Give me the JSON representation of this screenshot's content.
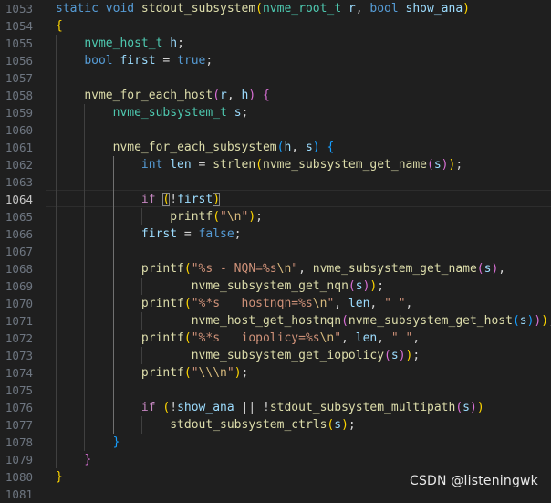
{
  "editor": {
    "active_line": "1064",
    "lines": [
      {
        "num": "1053",
        "tokens": [
          [
            "static void ",
            "t-kw"
          ],
          [
            "stdout_subsystem",
            "t-fn"
          ],
          [
            "(",
            "t-p1"
          ],
          [
            "nvme_root_t",
            "t-ty"
          ],
          [
            " ",
            "t-txt"
          ],
          [
            "r",
            "t-var"
          ],
          [
            ", ",
            "t-txt"
          ],
          [
            "bool",
            "t-kw"
          ],
          [
            " ",
            "t-txt"
          ],
          [
            "show_ana",
            "t-var"
          ],
          [
            ")",
            "t-p1"
          ]
        ]
      },
      {
        "num": "1054",
        "tokens": [
          [
            "{",
            "t-p1"
          ]
        ]
      },
      {
        "num": "1055",
        "tokens": [
          [
            "    ",
            "t-txt"
          ],
          [
            "nvme_host_t",
            "t-ty"
          ],
          [
            " ",
            "t-txt"
          ],
          [
            "h",
            "t-var"
          ],
          [
            ";",
            "t-txt"
          ]
        ]
      },
      {
        "num": "1056",
        "tokens": [
          [
            "    ",
            "t-txt"
          ],
          [
            "bool",
            "t-kw"
          ],
          [
            " ",
            "t-txt"
          ],
          [
            "first",
            "t-var"
          ],
          [
            " = ",
            "t-txt"
          ],
          [
            "true",
            "t-kw"
          ],
          [
            ";",
            "t-txt"
          ]
        ]
      },
      {
        "num": "1057",
        "tokens": []
      },
      {
        "num": "1058",
        "tokens": [
          [
            "    ",
            "t-txt"
          ],
          [
            "nvme_for_each_host",
            "t-fn"
          ],
          [
            "(",
            "t-p2"
          ],
          [
            "r",
            "t-var"
          ],
          [
            ", ",
            "t-txt"
          ],
          [
            "h",
            "t-var"
          ],
          [
            ")",
            "t-p2"
          ],
          [
            " ",
            "t-txt"
          ],
          [
            "{",
            "t-p2"
          ]
        ]
      },
      {
        "num": "1059",
        "tokens": [
          [
            "        ",
            "t-txt"
          ],
          [
            "nvme_subsystem_t",
            "t-ty"
          ],
          [
            " ",
            "t-txt"
          ],
          [
            "s",
            "t-var"
          ],
          [
            ";",
            "t-txt"
          ]
        ]
      },
      {
        "num": "1060",
        "tokens": []
      },
      {
        "num": "1061",
        "tokens": [
          [
            "        ",
            "t-txt"
          ],
          [
            "nvme_for_each_subsystem",
            "t-fn"
          ],
          [
            "(",
            "t-p3"
          ],
          [
            "h",
            "t-var"
          ],
          [
            ", ",
            "t-txt"
          ],
          [
            "s",
            "t-var"
          ],
          [
            ")",
            "t-p3"
          ],
          [
            " ",
            "t-txt"
          ],
          [
            "{",
            "t-p3"
          ]
        ]
      },
      {
        "num": "1062",
        "tokens": [
          [
            "            ",
            "t-txt"
          ],
          [
            "int",
            "t-kw"
          ],
          [
            " ",
            "t-txt"
          ],
          [
            "len",
            "t-var"
          ],
          [
            " = ",
            "t-txt"
          ],
          [
            "strlen",
            "t-fn"
          ],
          [
            "(",
            "t-p1"
          ],
          [
            "nvme_subsystem_get_name",
            "t-fn"
          ],
          [
            "(",
            "t-p2"
          ],
          [
            "s",
            "t-var"
          ],
          [
            ")",
            "t-p2"
          ],
          [
            ")",
            "t-p1"
          ],
          [
            ";",
            "t-txt"
          ]
        ]
      },
      {
        "num": "1063",
        "tokens": []
      },
      {
        "num": "1064",
        "tokens": [
          [
            "            ",
            "t-txt"
          ],
          [
            "if",
            "t-ctl"
          ],
          [
            " ",
            "t-txt"
          ],
          [
            "(",
            "t-p1 bracket-match"
          ],
          [
            "!",
            "t-txt"
          ],
          [
            "first",
            "t-var"
          ],
          [
            ")",
            "t-p1 bracket-match"
          ]
        ]
      },
      {
        "num": "1065",
        "tokens": [
          [
            "                ",
            "t-txt"
          ],
          [
            "printf",
            "t-fn"
          ],
          [
            "(",
            "t-p1"
          ],
          [
            "\"",
            "t-str"
          ],
          [
            "\\n",
            "t-esc"
          ],
          [
            "\"",
            "t-str"
          ],
          [
            ")",
            "t-p1"
          ],
          [
            ";",
            "t-txt"
          ]
        ]
      },
      {
        "num": "1066",
        "tokens": [
          [
            "            ",
            "t-txt"
          ],
          [
            "first",
            "t-var"
          ],
          [
            " = ",
            "t-txt"
          ],
          [
            "false",
            "t-kw"
          ],
          [
            ";",
            "t-txt"
          ]
        ]
      },
      {
        "num": "1067",
        "tokens": []
      },
      {
        "num": "1068",
        "tokens": [
          [
            "            ",
            "t-txt"
          ],
          [
            "printf",
            "t-fn"
          ],
          [
            "(",
            "t-p1"
          ],
          [
            "\"%s - NQN=%s",
            "t-str"
          ],
          [
            "\\n",
            "t-esc"
          ],
          [
            "\"",
            "t-str"
          ],
          [
            ", ",
            "t-txt"
          ],
          [
            "nvme_subsystem_get_name",
            "t-fn"
          ],
          [
            "(",
            "t-p2"
          ],
          [
            "s",
            "t-var"
          ],
          [
            ")",
            "t-p2"
          ],
          [
            ",",
            "t-txt"
          ]
        ]
      },
      {
        "num": "1069",
        "tokens": [
          [
            "                   ",
            "t-txt"
          ],
          [
            "nvme_subsystem_get_nqn",
            "t-fn"
          ],
          [
            "(",
            "t-p2"
          ],
          [
            "s",
            "t-var"
          ],
          [
            ")",
            "t-p2"
          ],
          [
            ")",
            "t-p1"
          ],
          [
            ";",
            "t-txt"
          ]
        ]
      },
      {
        "num": "1070",
        "tokens": [
          [
            "            ",
            "t-txt"
          ],
          [
            "printf",
            "t-fn"
          ],
          [
            "(",
            "t-p1"
          ],
          [
            "\"%*s   hostnqn=%s",
            "t-str"
          ],
          [
            "\\n",
            "t-esc"
          ],
          [
            "\"",
            "t-str"
          ],
          [
            ", ",
            "t-txt"
          ],
          [
            "len",
            "t-var"
          ],
          [
            ", ",
            "t-txt"
          ],
          [
            "\" \"",
            "t-str"
          ],
          [
            ",",
            "t-txt"
          ]
        ]
      },
      {
        "num": "1071",
        "tokens": [
          [
            "                   ",
            "t-txt"
          ],
          [
            "nvme_host_get_hostnqn",
            "t-fn"
          ],
          [
            "(",
            "t-p2"
          ],
          [
            "nvme_subsystem_get_host",
            "t-fn"
          ],
          [
            "(",
            "t-p3"
          ],
          [
            "s",
            "t-var"
          ],
          [
            ")",
            "t-p3"
          ],
          [
            ")",
            "t-p2"
          ],
          [
            ")",
            "t-p1"
          ],
          [
            ";",
            "t-txt"
          ]
        ]
      },
      {
        "num": "1072",
        "tokens": [
          [
            "            ",
            "t-txt"
          ],
          [
            "printf",
            "t-fn"
          ],
          [
            "(",
            "t-p1"
          ],
          [
            "\"%*s   iopolicy=%s",
            "t-str"
          ],
          [
            "\\n",
            "t-esc"
          ],
          [
            "\"",
            "t-str"
          ],
          [
            ", ",
            "t-txt"
          ],
          [
            "len",
            "t-var"
          ],
          [
            ", ",
            "t-txt"
          ],
          [
            "\" \"",
            "t-str"
          ],
          [
            ",",
            "t-txt"
          ]
        ]
      },
      {
        "num": "1073",
        "tokens": [
          [
            "                   ",
            "t-txt"
          ],
          [
            "nvme_subsystem_get_iopolicy",
            "t-fn"
          ],
          [
            "(",
            "t-p2"
          ],
          [
            "s",
            "t-var"
          ],
          [
            ")",
            "t-p2"
          ],
          [
            ")",
            "t-p1"
          ],
          [
            ";",
            "t-txt"
          ]
        ]
      },
      {
        "num": "1074",
        "tokens": [
          [
            "            ",
            "t-txt"
          ],
          [
            "printf",
            "t-fn"
          ],
          [
            "(",
            "t-p1"
          ],
          [
            "\"",
            "t-str"
          ],
          [
            "\\\\",
            "t-esc"
          ],
          [
            "\\n",
            "t-esc"
          ],
          [
            "\"",
            "t-str"
          ],
          [
            ")",
            "t-p1"
          ],
          [
            ";",
            "t-txt"
          ]
        ]
      },
      {
        "num": "1075",
        "tokens": []
      },
      {
        "num": "1076",
        "tokens": [
          [
            "            ",
            "t-txt"
          ],
          [
            "if",
            "t-ctl"
          ],
          [
            " ",
            "t-txt"
          ],
          [
            "(",
            "t-p1"
          ],
          [
            "!",
            "t-txt"
          ],
          [
            "show_ana",
            "t-var"
          ],
          [
            " || !",
            "t-txt"
          ],
          [
            "stdout_subsystem_multipath",
            "t-fn"
          ],
          [
            "(",
            "t-p2"
          ],
          [
            "s",
            "t-var"
          ],
          [
            ")",
            "t-p2"
          ],
          [
            ")",
            "t-p1"
          ]
        ]
      },
      {
        "num": "1077",
        "tokens": [
          [
            "                ",
            "t-txt"
          ],
          [
            "stdout_subsystem_ctrls",
            "t-fn"
          ],
          [
            "(",
            "t-p1"
          ],
          [
            "s",
            "t-var"
          ],
          [
            ")",
            "t-p1"
          ],
          [
            ";",
            "t-txt"
          ]
        ]
      },
      {
        "num": "1078",
        "tokens": [
          [
            "        ",
            "t-txt"
          ],
          [
            "}",
            "t-p3"
          ]
        ]
      },
      {
        "num": "1079",
        "tokens": [
          [
            "    ",
            "t-txt"
          ],
          [
            "}",
            "t-p2"
          ]
        ]
      },
      {
        "num": "1080",
        "tokens": [
          [
            "}",
            "t-p1"
          ]
        ]
      },
      {
        "num": "1081",
        "tokens": []
      }
    ]
  },
  "watermark": {
    "text": "CSDN @listeningwk"
  },
  "colors": {
    "background": "#1f1f1f",
    "line_number": "#6e7681",
    "keyword": "#569cd6",
    "type": "#4ec9b0",
    "function": "#dcdcaa",
    "variable": "#9cdcfe",
    "string": "#ce9178"
  }
}
